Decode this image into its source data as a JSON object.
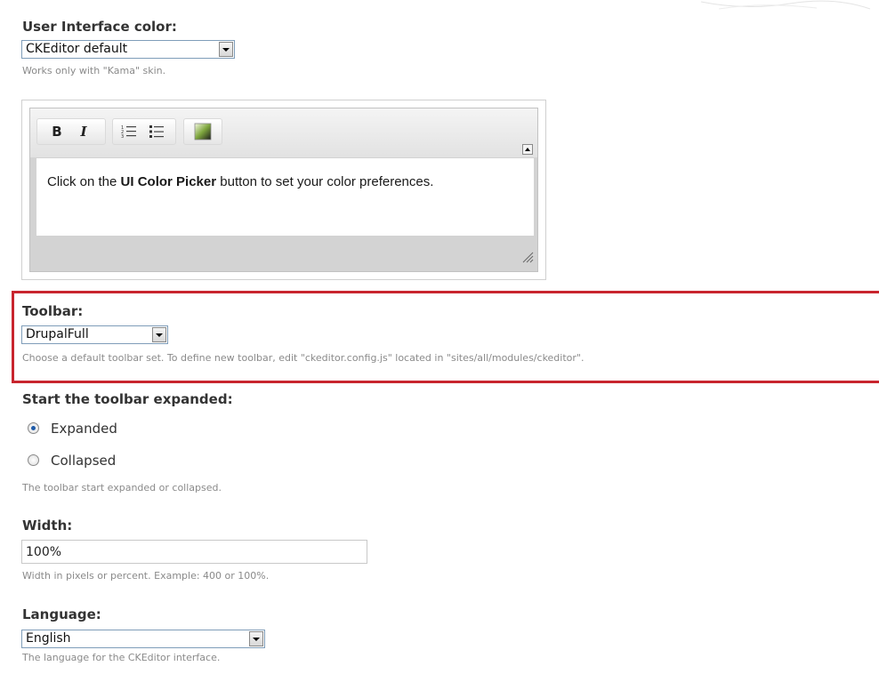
{
  "ui_color": {
    "label": "User Interface color:",
    "selected": "CKEditor default",
    "description": "Works only with \"Kama\" skin."
  },
  "editor_preview": {
    "toolbar_buttons": [
      "bold-icon",
      "italic-icon",
      "numbered-list-icon",
      "bulleted-list-icon",
      "ui-color-picker-icon"
    ],
    "bold_label": "B",
    "italic_label": "I",
    "text_before": "Click on the ",
    "text_bold": "UI Color Picker",
    "text_after": " button to set your color preferences."
  },
  "toolbar": {
    "label": "Toolbar:",
    "selected": "DrupalFull",
    "description": "Choose a default toolbar set. To define new toolbar, edit \"ckeditor.config.js\" located in \"sites/all/modules/ckeditor\"."
  },
  "toolbar_expanded": {
    "label": "Start the toolbar expanded:",
    "options": [
      {
        "label": "Expanded",
        "checked": true
      },
      {
        "label": "Collapsed",
        "checked": false
      }
    ],
    "description": "The toolbar start expanded or collapsed."
  },
  "width": {
    "label": "Width:",
    "value": "100%",
    "description": "Width in pixels or percent. Example: 400 or 100%."
  },
  "language": {
    "label": "Language:",
    "selected": "English",
    "description": "The language for the CKEditor interface."
  },
  "colors": {
    "highlight_border": "#c8252e",
    "label_text": "#333333",
    "description_text": "#8a8a8a",
    "editor_chrome": "#d3d3d3"
  }
}
